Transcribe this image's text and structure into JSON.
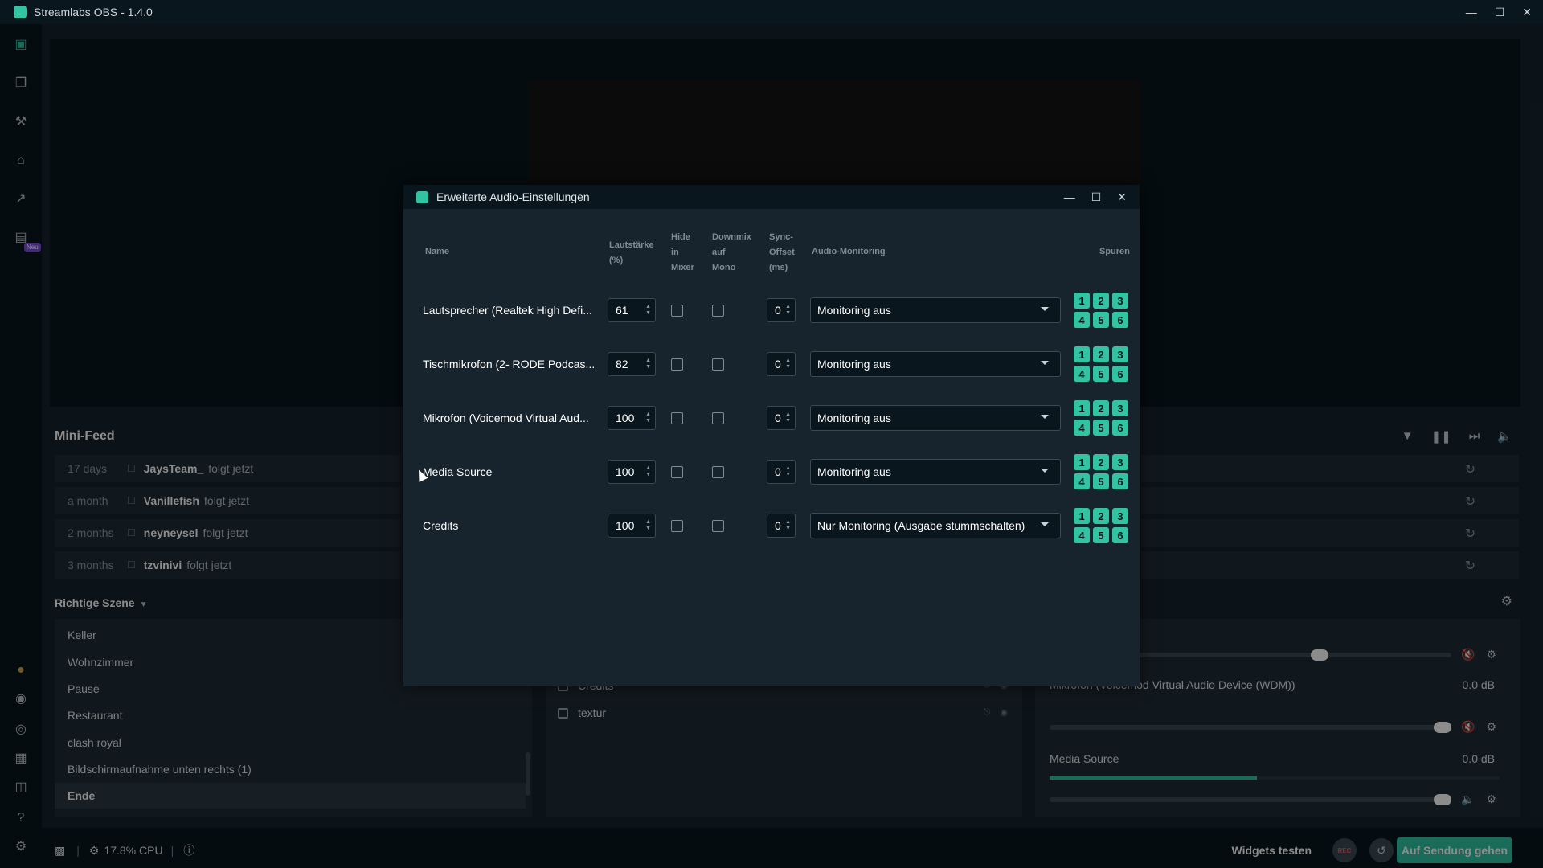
{
  "app": {
    "title": "Streamlabs OBS - 1.4.0"
  },
  "nav": {
    "badge": "Neu"
  },
  "minifeed": {
    "title": "Mini-Feed",
    "items": [
      {
        "ago": "17 days",
        "user": "JaysTeam_",
        "action": "folgt jetzt"
      },
      {
        "ago": "a month",
        "user": "Vanillefish",
        "action": "folgt jetzt"
      },
      {
        "ago": "2 months",
        "user": "neyneysel",
        "action": "folgt jetzt"
      },
      {
        "ago": "3 months",
        "user": "tzvinivi",
        "action": "folgt jetzt"
      }
    ]
  },
  "scenes": {
    "header": "Richtige Szene",
    "items": [
      "Keller",
      "Wohnzimmer",
      "Pause",
      "Restaurant",
      "clash royal",
      "Bildschirmaufnahme unten rechts (1)",
      "Ende"
    ],
    "selected": "Ende"
  },
  "sources": {
    "items": [
      "Credits",
      "textur"
    ]
  },
  "mixer": {
    "items": [
      {
        "name": "Mikrofon (Voicemod Virtual Audio Device (WDM))",
        "db": "0.0 dB",
        "level": 1.0
      },
      {
        "name": "Media Source",
        "db": "0.0 dB",
        "level": 1.0,
        "meter": 0.46
      }
    ],
    "first_slider_level": 0.68
  },
  "status": {
    "cpu": "17.8% CPU",
    "widgets": "Widgets testen",
    "rec": "REC",
    "golive": "Auf Sendung gehen"
  },
  "dialog": {
    "title": "Erweiterte Audio-Einstellungen",
    "headers": {
      "name": "Name",
      "volume_1": "Lautstärke",
      "volume_2": "(%)",
      "hide_1": "Hide",
      "hide_2": "in",
      "hide_3": "Mixer",
      "downmix_1": "Downmix",
      "downmix_2": "auf",
      "downmix_3": "Mono",
      "sync_1": "Sync-",
      "sync_2": "Offset",
      "sync_3": "(ms)",
      "monitoring": "Audio-Monitoring",
      "tracks": "Spuren"
    },
    "rows": [
      {
        "name": "Lautsprecher (Realtek High Defi...",
        "volume": "61",
        "sync": "0",
        "monitoring": "Monitoring aus"
      },
      {
        "name": "Tischmikrofon (2- RODE Podcas...",
        "volume": "82",
        "sync": "0",
        "monitoring": "Monitoring aus"
      },
      {
        "name": "Mikrofon (Voicemod Virtual Aud...",
        "volume": "100",
        "sync": "0",
        "monitoring": "Monitoring aus"
      },
      {
        "name": "Media Source",
        "volume": "100",
        "sync": "0",
        "monitoring": "Monitoring aus"
      },
      {
        "name": "Credits",
        "volume": "100",
        "sync": "0",
        "monitoring": "Nur Monitoring (Ausgabe stummschalten)"
      }
    ],
    "track_labels": [
      "1",
      "2",
      "3",
      "4",
      "5",
      "6"
    ]
  }
}
